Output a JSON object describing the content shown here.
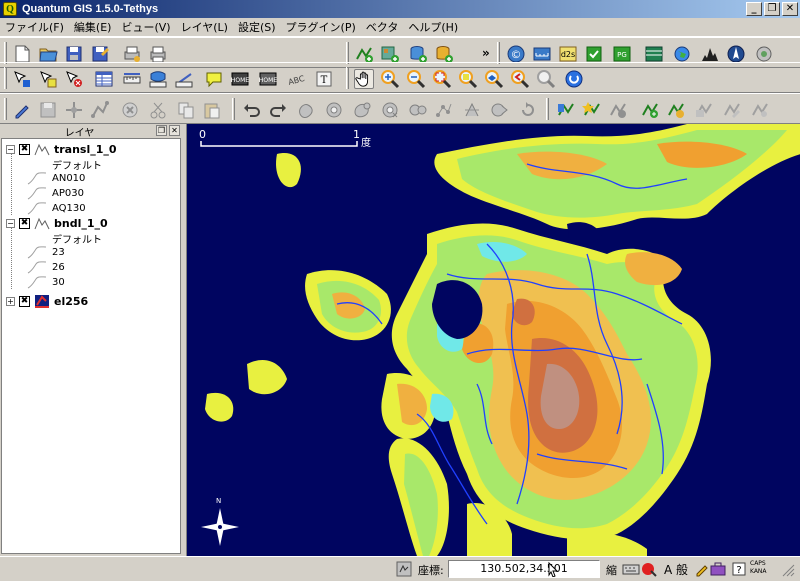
{
  "window": {
    "title": "Quantum GIS 1.5.0-Tethys",
    "app_icon": "Q",
    "minimize": "_",
    "restore": "❐",
    "close": "✕"
  },
  "menu": [
    "ファイル(F)",
    "編集(E)",
    "ビュー(V)",
    "レイヤ(L)",
    "設定(S)",
    "プラグイン(P)",
    "ベクタ",
    "ヘルプ(H)"
  ],
  "toolbar_overflow": "»",
  "layer_panel": {
    "title": "レイヤ",
    "float_btn": "❐",
    "close_btn": "✕",
    "layers": [
      {
        "name": "transl_1_0",
        "checked": "✖",
        "expander": "−",
        "items": [
          "デフォルト",
          "AN010",
          "AP030",
          "AQ130"
        ]
      },
      {
        "name": "bndl_1_0",
        "checked": "✖",
        "expander": "−",
        "items": [
          "デフォルト",
          "23",
          "26",
          "30"
        ]
      },
      {
        "name": "el256",
        "checked": "✖",
        "expander": "+",
        "items": []
      }
    ]
  },
  "map": {
    "scale_start": "0",
    "scale_end": "1",
    "scale_unit": "度",
    "north_label": "N",
    "colors": {
      "sea": "#000560",
      "lowland": "#a8e86a",
      "coast": "#e8f040",
      "hills": "#f0a030",
      "mountains": "#d07040",
      "peaks": "#b0a0a0",
      "rivers": "#2040ff",
      "shallow": "#70e8e8"
    }
  },
  "statusbar": {
    "coord_label": "座標:",
    "coord_value": "130.502,34.501",
    "scale_label": "縮",
    "render_label": "A 般",
    "caps": "CAPS",
    "kana": "KANA"
  },
  "icons": [
    "new-project-icon",
    "open-project-icon",
    "save-icon",
    "save-as-icon",
    "print-composer-icon",
    "print-icon",
    "add-vector-icon",
    "add-raster-icon",
    "add-postgis-icon",
    "new-layer-icon",
    "pan-icon",
    "zoom-in-icon",
    "zoom-out-icon",
    "zoom-full-icon",
    "identify-icon",
    "measure-icon",
    "digitize-icon",
    "north-arrow-icon",
    "globe-icon"
  ]
}
